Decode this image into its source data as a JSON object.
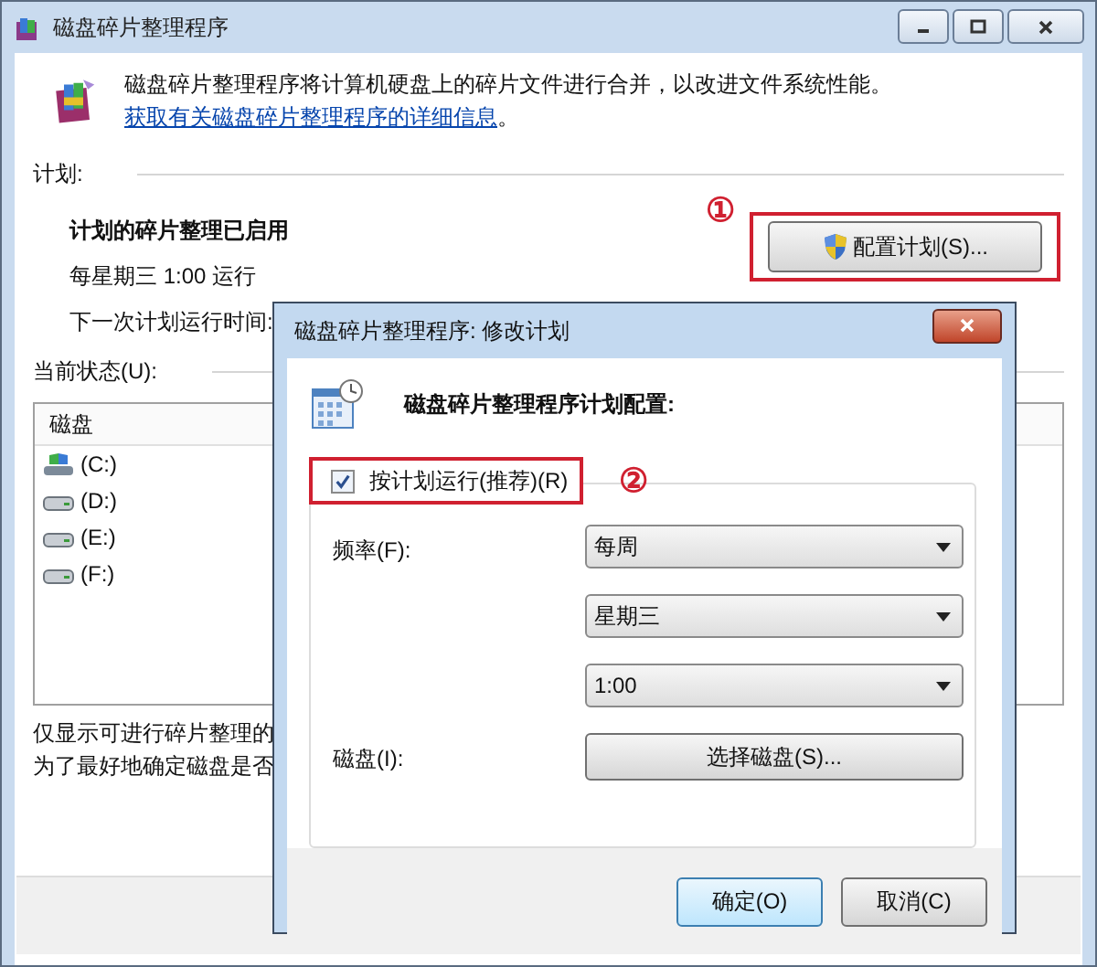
{
  "window": {
    "title": "磁盘碎片整理程序"
  },
  "intro": {
    "text": "磁盘碎片整理程序将计算机硬盘上的碎片文件进行合并，以改进文件系统性能。",
    "link": "获取有关磁盘碎片整理程序的详细信息",
    "end": "。"
  },
  "schedule": {
    "label": "计划:",
    "status": "计划的碎片整理已启用",
    "time": "每星期三  1:00 运行",
    "next_run": "下一次计划运行时间:",
    "button": "配置计划(S)...",
    "annotation": "①"
  },
  "current_status": {
    "label": "当前状态(U):",
    "columns": [
      "磁盘"
    ],
    "rows": [
      {
        "name": "(C:)",
        "kind": "system"
      },
      {
        "name": "(D:)",
        "kind": "drive"
      },
      {
        "name": "(E:)",
        "kind": "drive"
      },
      {
        "name": "(F:)",
        "kind": "drive"
      }
    ]
  },
  "notes": [
    "仅显示可进行碎片整理的",
    "为了最好地确定磁盘是否"
  ],
  "dialog": {
    "title": "磁盘碎片整理程序: 修改计划",
    "heading": "磁盘碎片整理程序计划配置:",
    "run_on_schedule": {
      "label": "按计划运行(推荐)(R)",
      "checked": true,
      "annotation": "②"
    },
    "frequency_label": "频率(F):",
    "dropdowns": [
      {
        "value": "每周"
      },
      {
        "value": "星期三"
      },
      {
        "value": "1:00"
      }
    ],
    "disks_label": "磁盘(I):",
    "select_disks_button": "选择磁盘(S)...",
    "buttons": [
      {
        "label": "确定(O)",
        "default": true
      },
      {
        "label": "取消(C)",
        "default": false
      }
    ]
  }
}
